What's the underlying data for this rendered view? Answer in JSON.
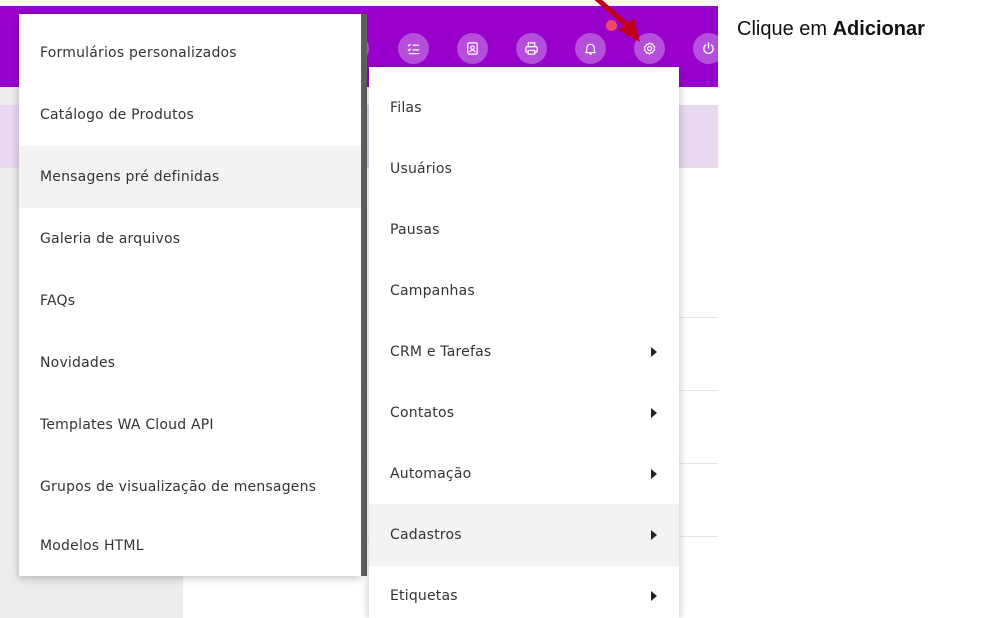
{
  "colors": {
    "topbar": "#9900cc",
    "icon_circle": "#b54fdb",
    "notification_dot": "#f2496a",
    "annotation_arrow": "#c00018"
  },
  "toolbar": {
    "icons": [
      "checklist-icon",
      "contact-book-icon",
      "printer-icon",
      "bell-icon",
      "gear-icon",
      "power-icon"
    ]
  },
  "left_menu": {
    "items": [
      {
        "label": "Formulários personalizados"
      },
      {
        "label": "Catálogo de Produtos"
      },
      {
        "label": "Mensagens pré definidas",
        "highlighted": true
      },
      {
        "label": "Galeria de arquivos"
      },
      {
        "label": "FAQs"
      },
      {
        "label": "Novidades"
      },
      {
        "label": "Templates WA Cloud API"
      },
      {
        "label": "Grupos de visualização de mensagens"
      },
      {
        "label": "Modelos HTML"
      }
    ]
  },
  "right_menu": {
    "items": [
      {
        "label": "Filas"
      },
      {
        "label": "Usuários"
      },
      {
        "label": "Pausas"
      },
      {
        "label": "Campanhas"
      },
      {
        "label": "CRM e Tarefas",
        "submenu": true
      },
      {
        "label": "Contatos",
        "submenu": true
      },
      {
        "label": "Automação",
        "submenu": true
      },
      {
        "label": "Cadastros",
        "submenu": true,
        "highlighted": true
      },
      {
        "label": "Etiquetas",
        "submenu": true
      }
    ]
  },
  "instruction": {
    "prefix": "Clique em ",
    "emphasis": "Adicionar"
  }
}
